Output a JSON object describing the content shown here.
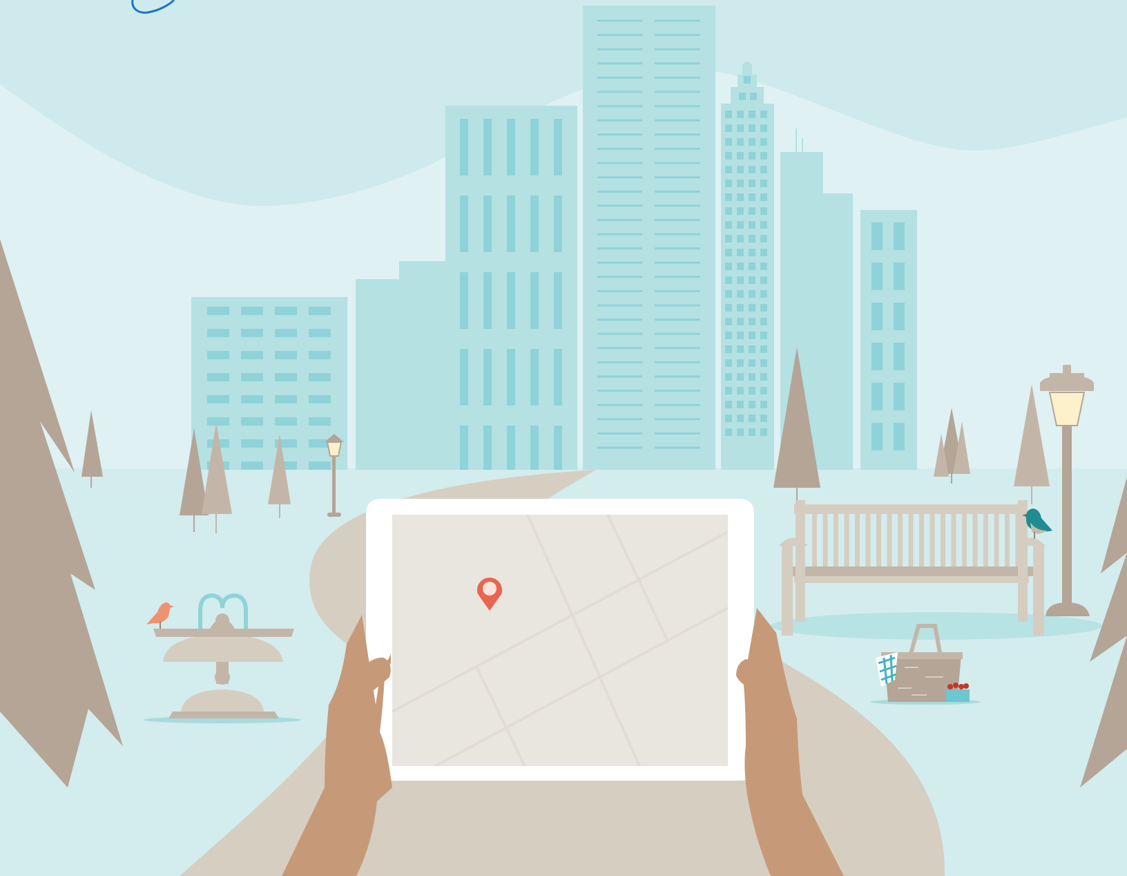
{
  "illustration": {
    "subject": "park-city-tablet-map",
    "colors": {
      "sky": "#dff1f3",
      "cloud_band": "#cfeaec",
      "ground": "#d3ecee",
      "building": "#b5e1e3",
      "building_window": "#8fd3d8",
      "path": "#d7cec2",
      "tree": "#b4a597",
      "tree_light": "#c3b6a9",
      "bench": "#d6cdc1",
      "tablet_frame": "#ffffff",
      "tablet_screen": "#e9e5df",
      "map_road": "#e1ddd6",
      "pin": "#e8654f",
      "hand": "#c69a78",
      "bird_teal": "#1f8c94",
      "bird_orange": "#ee9272",
      "lamp_glow": "#fdf1cc",
      "logo_stroke": "#1a73c8"
    },
    "icons": [
      "map-pin-icon",
      "bird-icon",
      "street-lamp-icon",
      "picnic-basket-icon",
      "fountain-icon",
      "bench-icon",
      "tree-icon"
    ]
  }
}
